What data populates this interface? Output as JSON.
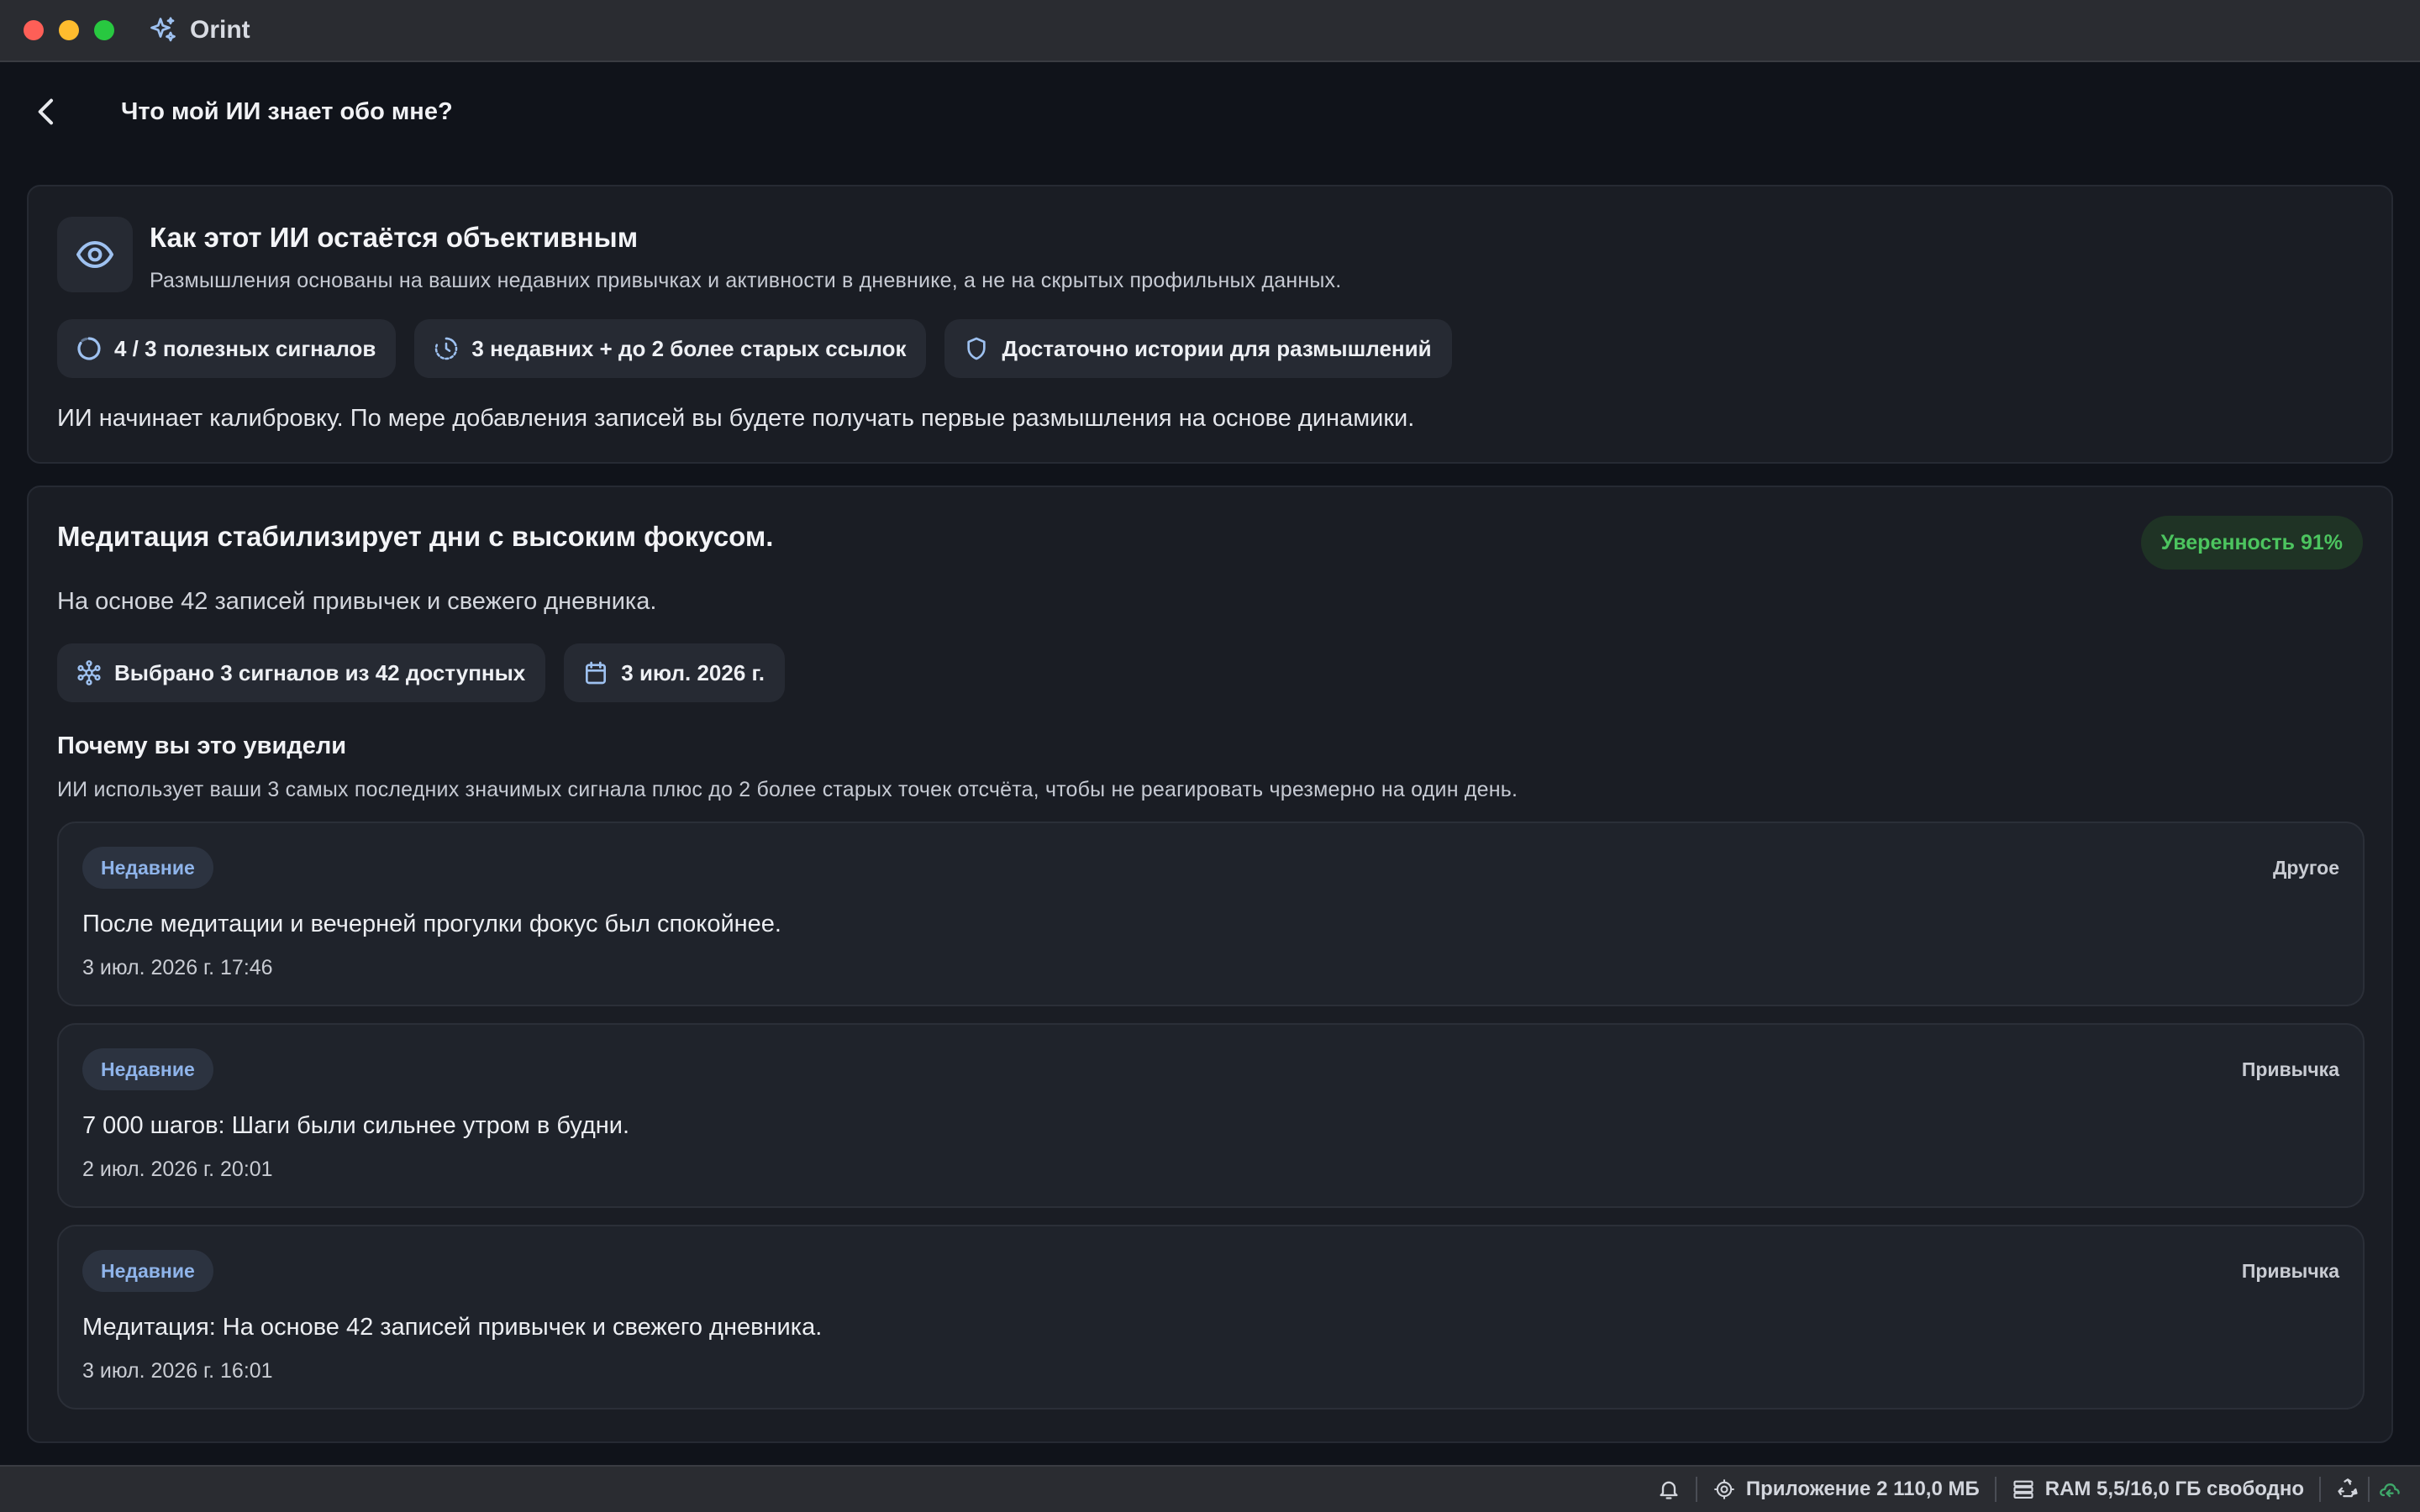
{
  "window": {
    "app_name": "Orint"
  },
  "header": {
    "title": "Что мой ИИ знает обо мне?"
  },
  "objectivity": {
    "title": "Как этот ИИ остаётся объективным",
    "subtitle": "Размышления основаны на ваших недавних привычках и активности в дневнике, а не на скрытых профильных данных.",
    "chips": [
      {
        "icon": "progress-ring-icon",
        "label": "4 / 3 полезных сигналов"
      },
      {
        "icon": "clock-history-icon",
        "label": "3 недавних + до 2 более старых ссылок"
      },
      {
        "icon": "shield-icon",
        "label": "Достаточно истории для размышлений"
      }
    ],
    "note": "ИИ начинает калибровку. По мере добавления записей вы будете получать первые размышления на основе динамики."
  },
  "insight": {
    "title": "Медитация стабилизирует дни с высоким фокусом.",
    "confidence": "Уверенность 91%",
    "subtitle": "На основе 42 записей привычек и свежего дневника.",
    "chips": [
      {
        "icon": "network-icon",
        "label": "Выбрано 3 сигналов из 42 доступных"
      },
      {
        "icon": "calendar-icon",
        "label": "3 июл. 2026 г."
      }
    ],
    "why_title": "Почему вы это увидели",
    "why_subtitle": "ИИ использует ваши 3 самых последних значимых сигнала плюс до 2 более старых точек отсчёта, чтобы не реагировать чрезмерно на один день.",
    "signals": [
      {
        "badge": "Недавние",
        "category": "Другое",
        "text": "После медитации и вечерней прогулки фокус был спокойнее.",
        "date": "3 июл. 2026 г. 17:46"
      },
      {
        "badge": "Недавние",
        "category": "Привычка",
        "text": "7 000 шагов: Шаги были сильнее утром в будни.",
        "date": "2 июл. 2026 г. 20:01"
      },
      {
        "badge": "Недавние",
        "category": "Привычка",
        "text": "Медитация: На основе 42 записей привычек и свежего дневника.",
        "date": "3 июл. 2026 г. 16:01"
      }
    ]
  },
  "statusbar": {
    "app_memory": "Приложение 2 110,0 МБ",
    "ram": "RAM 5,5/16,0 ГБ свободно"
  },
  "colors": {
    "accent": "#8fb4ea",
    "confidence": "#4cc45f",
    "background": "#10131a",
    "card": "#1a1d24"
  }
}
